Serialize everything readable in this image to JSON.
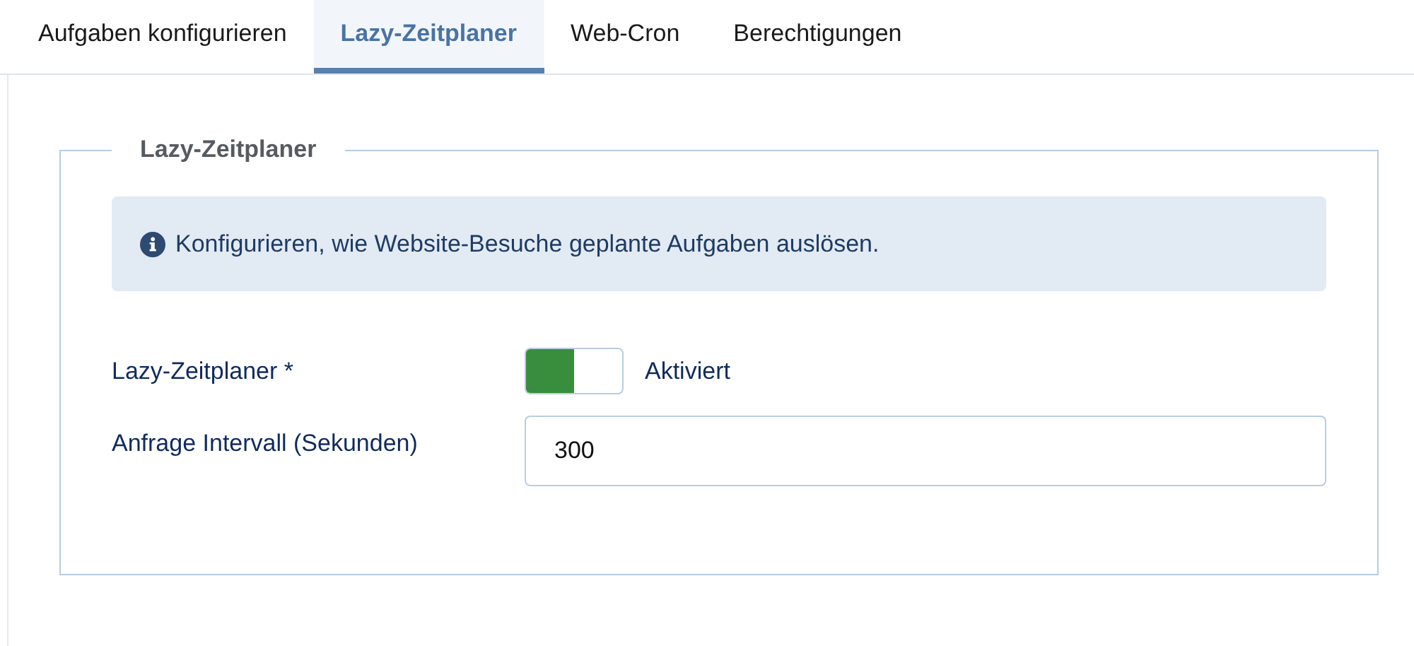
{
  "tabs": [
    {
      "label": "Aufgaben konfigurieren",
      "selected": false
    },
    {
      "label": "Lazy-Zeitplaner",
      "selected": true
    },
    {
      "label": "Web-Cron",
      "selected": false
    },
    {
      "label": "Berechtigungen",
      "selected": false
    }
  ],
  "fieldset": {
    "legend": "Lazy-Zeitplaner",
    "alert": {
      "text": "Konfigurieren, wie Website-Besuche geplante Aufgaben auslösen."
    },
    "fields": [
      {
        "kind": "switch",
        "label": "Lazy-Zeitplaner *",
        "on": true,
        "state_label": "Aktiviert"
      },
      {
        "kind": "text",
        "label": "Anfrage Intervall (Sekunden)",
        "value": "300"
      }
    ]
  }
}
